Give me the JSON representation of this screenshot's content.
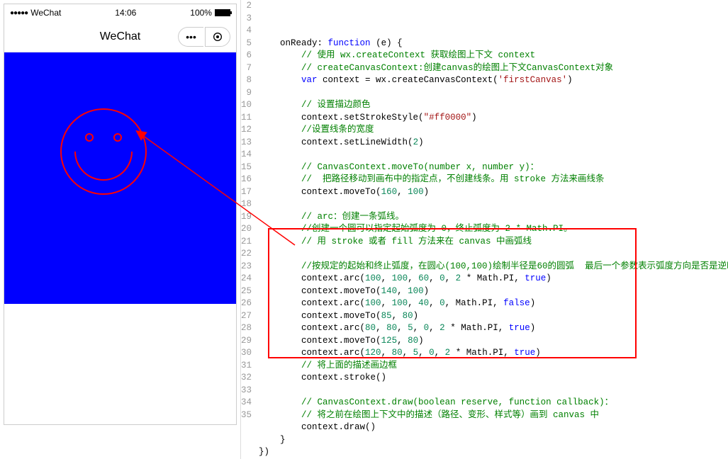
{
  "phone": {
    "statusBar": {
      "carrier": "WeChat",
      "time": "14:06",
      "battery": "100%"
    },
    "navBar": {
      "title": "WeChat"
    },
    "canvas": {
      "bgColor": "#0000ff",
      "strokeColor": "#ff0000"
    }
  },
  "code": {
    "startLine": 2,
    "lines": [
      {
        "indent": 2,
        "tokens": [
          {
            "t": "onReady: ",
            "c": ""
          },
          {
            "t": "function",
            "c": "kw"
          },
          {
            "t": " (e) {",
            "c": ""
          }
        ]
      },
      {
        "indent": 4,
        "tokens": [
          {
            "t": "// 使用 wx.createContext 获取绘图上下文 context",
            "c": "com"
          }
        ]
      },
      {
        "indent": 4,
        "tokens": [
          {
            "t": "// createCanvasContext:创建canvas的绘图上下文CanvasContext对象",
            "c": "com"
          }
        ]
      },
      {
        "indent": 4,
        "tokens": [
          {
            "t": "var",
            "c": "kw"
          },
          {
            "t": " context = wx.createCanvasContext(",
            "c": ""
          },
          {
            "t": "'firstCanvas'",
            "c": "str"
          },
          {
            "t": ")",
            "c": ""
          }
        ]
      },
      {
        "indent": 4,
        "tokens": []
      },
      {
        "indent": 4,
        "tokens": [
          {
            "t": "// 设置描边颜色",
            "c": "com"
          }
        ]
      },
      {
        "indent": 4,
        "tokens": [
          {
            "t": "context.setStrokeStyle(",
            "c": ""
          },
          {
            "t": "\"#ff0000\"",
            "c": "str"
          },
          {
            "t": ")",
            "c": ""
          }
        ]
      },
      {
        "indent": 4,
        "tokens": [
          {
            "t": "//设置线条的宽度",
            "c": "com"
          }
        ]
      },
      {
        "indent": 4,
        "tokens": [
          {
            "t": "context.setLineWidth(",
            "c": ""
          },
          {
            "t": "2",
            "c": "num"
          },
          {
            "t": ")",
            "c": ""
          }
        ]
      },
      {
        "indent": 4,
        "tokens": []
      },
      {
        "indent": 4,
        "tokens": [
          {
            "t": "// CanvasContext.moveTo(number x, number y)：",
            "c": "com"
          }
        ]
      },
      {
        "indent": 4,
        "tokens": [
          {
            "t": "//  把路径移动到画布中的指定点，不创建线条。用 stroke 方法来画线条",
            "c": "com"
          }
        ]
      },
      {
        "indent": 4,
        "tokens": [
          {
            "t": "context.moveTo(",
            "c": ""
          },
          {
            "t": "160",
            "c": "num"
          },
          {
            "t": ", ",
            "c": ""
          },
          {
            "t": "100",
            "c": "num"
          },
          {
            "t": ")",
            "c": ""
          }
        ]
      },
      {
        "indent": 4,
        "tokens": []
      },
      {
        "indent": 4,
        "tokens": [
          {
            "t": "// arc：创建一条弧线。",
            "c": "com"
          }
        ]
      },
      {
        "indent": 4,
        "tokens": [
          {
            "t": "//创建一个圆可以指定起始弧度为 0，终止弧度为 2 * Math.PI。",
            "c": "com"
          }
        ]
      },
      {
        "indent": 4,
        "tokens": [
          {
            "t": "// 用 stroke 或者 fill 方法来在 canvas 中画弧线",
            "c": "com"
          }
        ]
      },
      {
        "indent": 4,
        "tokens": []
      },
      {
        "indent": 4,
        "tokens": [
          {
            "t": "//按规定的起始和终止弧度，在圆心(100,100)绘制半径是60的圆弧",
            "c": "com"
          },
          {
            "t": "  最后一个参数表示弧度方向是否是逆时针",
            "c": "com"
          }
        ]
      },
      {
        "indent": 4,
        "tokens": [
          {
            "t": "context.arc(",
            "c": ""
          },
          {
            "t": "100",
            "c": "num"
          },
          {
            "t": ", ",
            "c": ""
          },
          {
            "t": "100",
            "c": "num"
          },
          {
            "t": ", ",
            "c": ""
          },
          {
            "t": "60",
            "c": "num"
          },
          {
            "t": ", ",
            "c": ""
          },
          {
            "t": "0",
            "c": "num"
          },
          {
            "t": ", ",
            "c": ""
          },
          {
            "t": "2",
            "c": "num"
          },
          {
            "t": " * Math.PI, ",
            "c": ""
          },
          {
            "t": "true",
            "c": "kw"
          },
          {
            "t": ")",
            "c": ""
          }
        ]
      },
      {
        "indent": 4,
        "tokens": [
          {
            "t": "context.moveTo(",
            "c": ""
          },
          {
            "t": "140",
            "c": "num"
          },
          {
            "t": ", ",
            "c": ""
          },
          {
            "t": "100",
            "c": "num"
          },
          {
            "t": ")",
            "c": ""
          }
        ]
      },
      {
        "indent": 4,
        "tokens": [
          {
            "t": "context.arc(",
            "c": ""
          },
          {
            "t": "100",
            "c": "num"
          },
          {
            "t": ", ",
            "c": ""
          },
          {
            "t": "100",
            "c": "num"
          },
          {
            "t": ", ",
            "c": ""
          },
          {
            "t": "40",
            "c": "num"
          },
          {
            "t": ", ",
            "c": ""
          },
          {
            "t": "0",
            "c": "num"
          },
          {
            "t": ", Math.PI, ",
            "c": ""
          },
          {
            "t": "false",
            "c": "kw"
          },
          {
            "t": ")",
            "c": ""
          }
        ]
      },
      {
        "indent": 4,
        "tokens": [
          {
            "t": "context.moveTo(",
            "c": ""
          },
          {
            "t": "85",
            "c": "num"
          },
          {
            "t": ", ",
            "c": ""
          },
          {
            "t": "80",
            "c": "num"
          },
          {
            "t": ")",
            "c": ""
          }
        ]
      },
      {
        "indent": 4,
        "tokens": [
          {
            "t": "context.arc(",
            "c": ""
          },
          {
            "t": "80",
            "c": "num"
          },
          {
            "t": ", ",
            "c": ""
          },
          {
            "t": "80",
            "c": "num"
          },
          {
            "t": ", ",
            "c": ""
          },
          {
            "t": "5",
            "c": "num"
          },
          {
            "t": ", ",
            "c": ""
          },
          {
            "t": "0",
            "c": "num"
          },
          {
            "t": ", ",
            "c": ""
          },
          {
            "t": "2",
            "c": "num"
          },
          {
            "t": " * Math.PI, ",
            "c": ""
          },
          {
            "t": "true",
            "c": "kw"
          },
          {
            "t": ")",
            "c": ""
          }
        ]
      },
      {
        "indent": 4,
        "tokens": [
          {
            "t": "context.moveTo(",
            "c": ""
          },
          {
            "t": "125",
            "c": "num"
          },
          {
            "t": ", ",
            "c": ""
          },
          {
            "t": "80",
            "c": "num"
          },
          {
            "t": ")",
            "c": ""
          }
        ]
      },
      {
        "indent": 4,
        "tokens": [
          {
            "t": "context.arc(",
            "c": ""
          },
          {
            "t": "120",
            "c": "num"
          },
          {
            "t": ", ",
            "c": ""
          },
          {
            "t": "80",
            "c": "num"
          },
          {
            "t": ", ",
            "c": ""
          },
          {
            "t": "5",
            "c": "num"
          },
          {
            "t": ", ",
            "c": ""
          },
          {
            "t": "0",
            "c": "num"
          },
          {
            "t": ", ",
            "c": ""
          },
          {
            "t": "2",
            "c": "num"
          },
          {
            "t": " * Math.PI, ",
            "c": ""
          },
          {
            "t": "true",
            "c": "kw"
          },
          {
            "t": ")",
            "c": ""
          }
        ]
      },
      {
        "indent": 4,
        "tokens": [
          {
            "t": "// 将上面的描述画边框",
            "c": "com"
          }
        ]
      },
      {
        "indent": 4,
        "tokens": [
          {
            "t": "context.stroke()",
            "c": ""
          }
        ]
      },
      {
        "indent": 4,
        "tokens": []
      },
      {
        "indent": 4,
        "tokens": [
          {
            "t": "// CanvasContext.draw(boolean reserve, function callback)：",
            "c": "com"
          }
        ]
      },
      {
        "indent": 4,
        "tokens": [
          {
            "t": "// 将之前在绘图上下文中的描述（路径、变形、样式等）画到 canvas 中",
            "c": "com"
          }
        ]
      },
      {
        "indent": 4,
        "tokens": [
          {
            "t": "context.draw()",
            "c": ""
          }
        ]
      },
      {
        "indent": 2,
        "tokens": [
          {
            "t": "}",
            "c": ""
          }
        ]
      },
      {
        "indent": 0,
        "tokens": [
          {
            "t": "})",
            "c": ""
          }
        ]
      }
    ]
  }
}
